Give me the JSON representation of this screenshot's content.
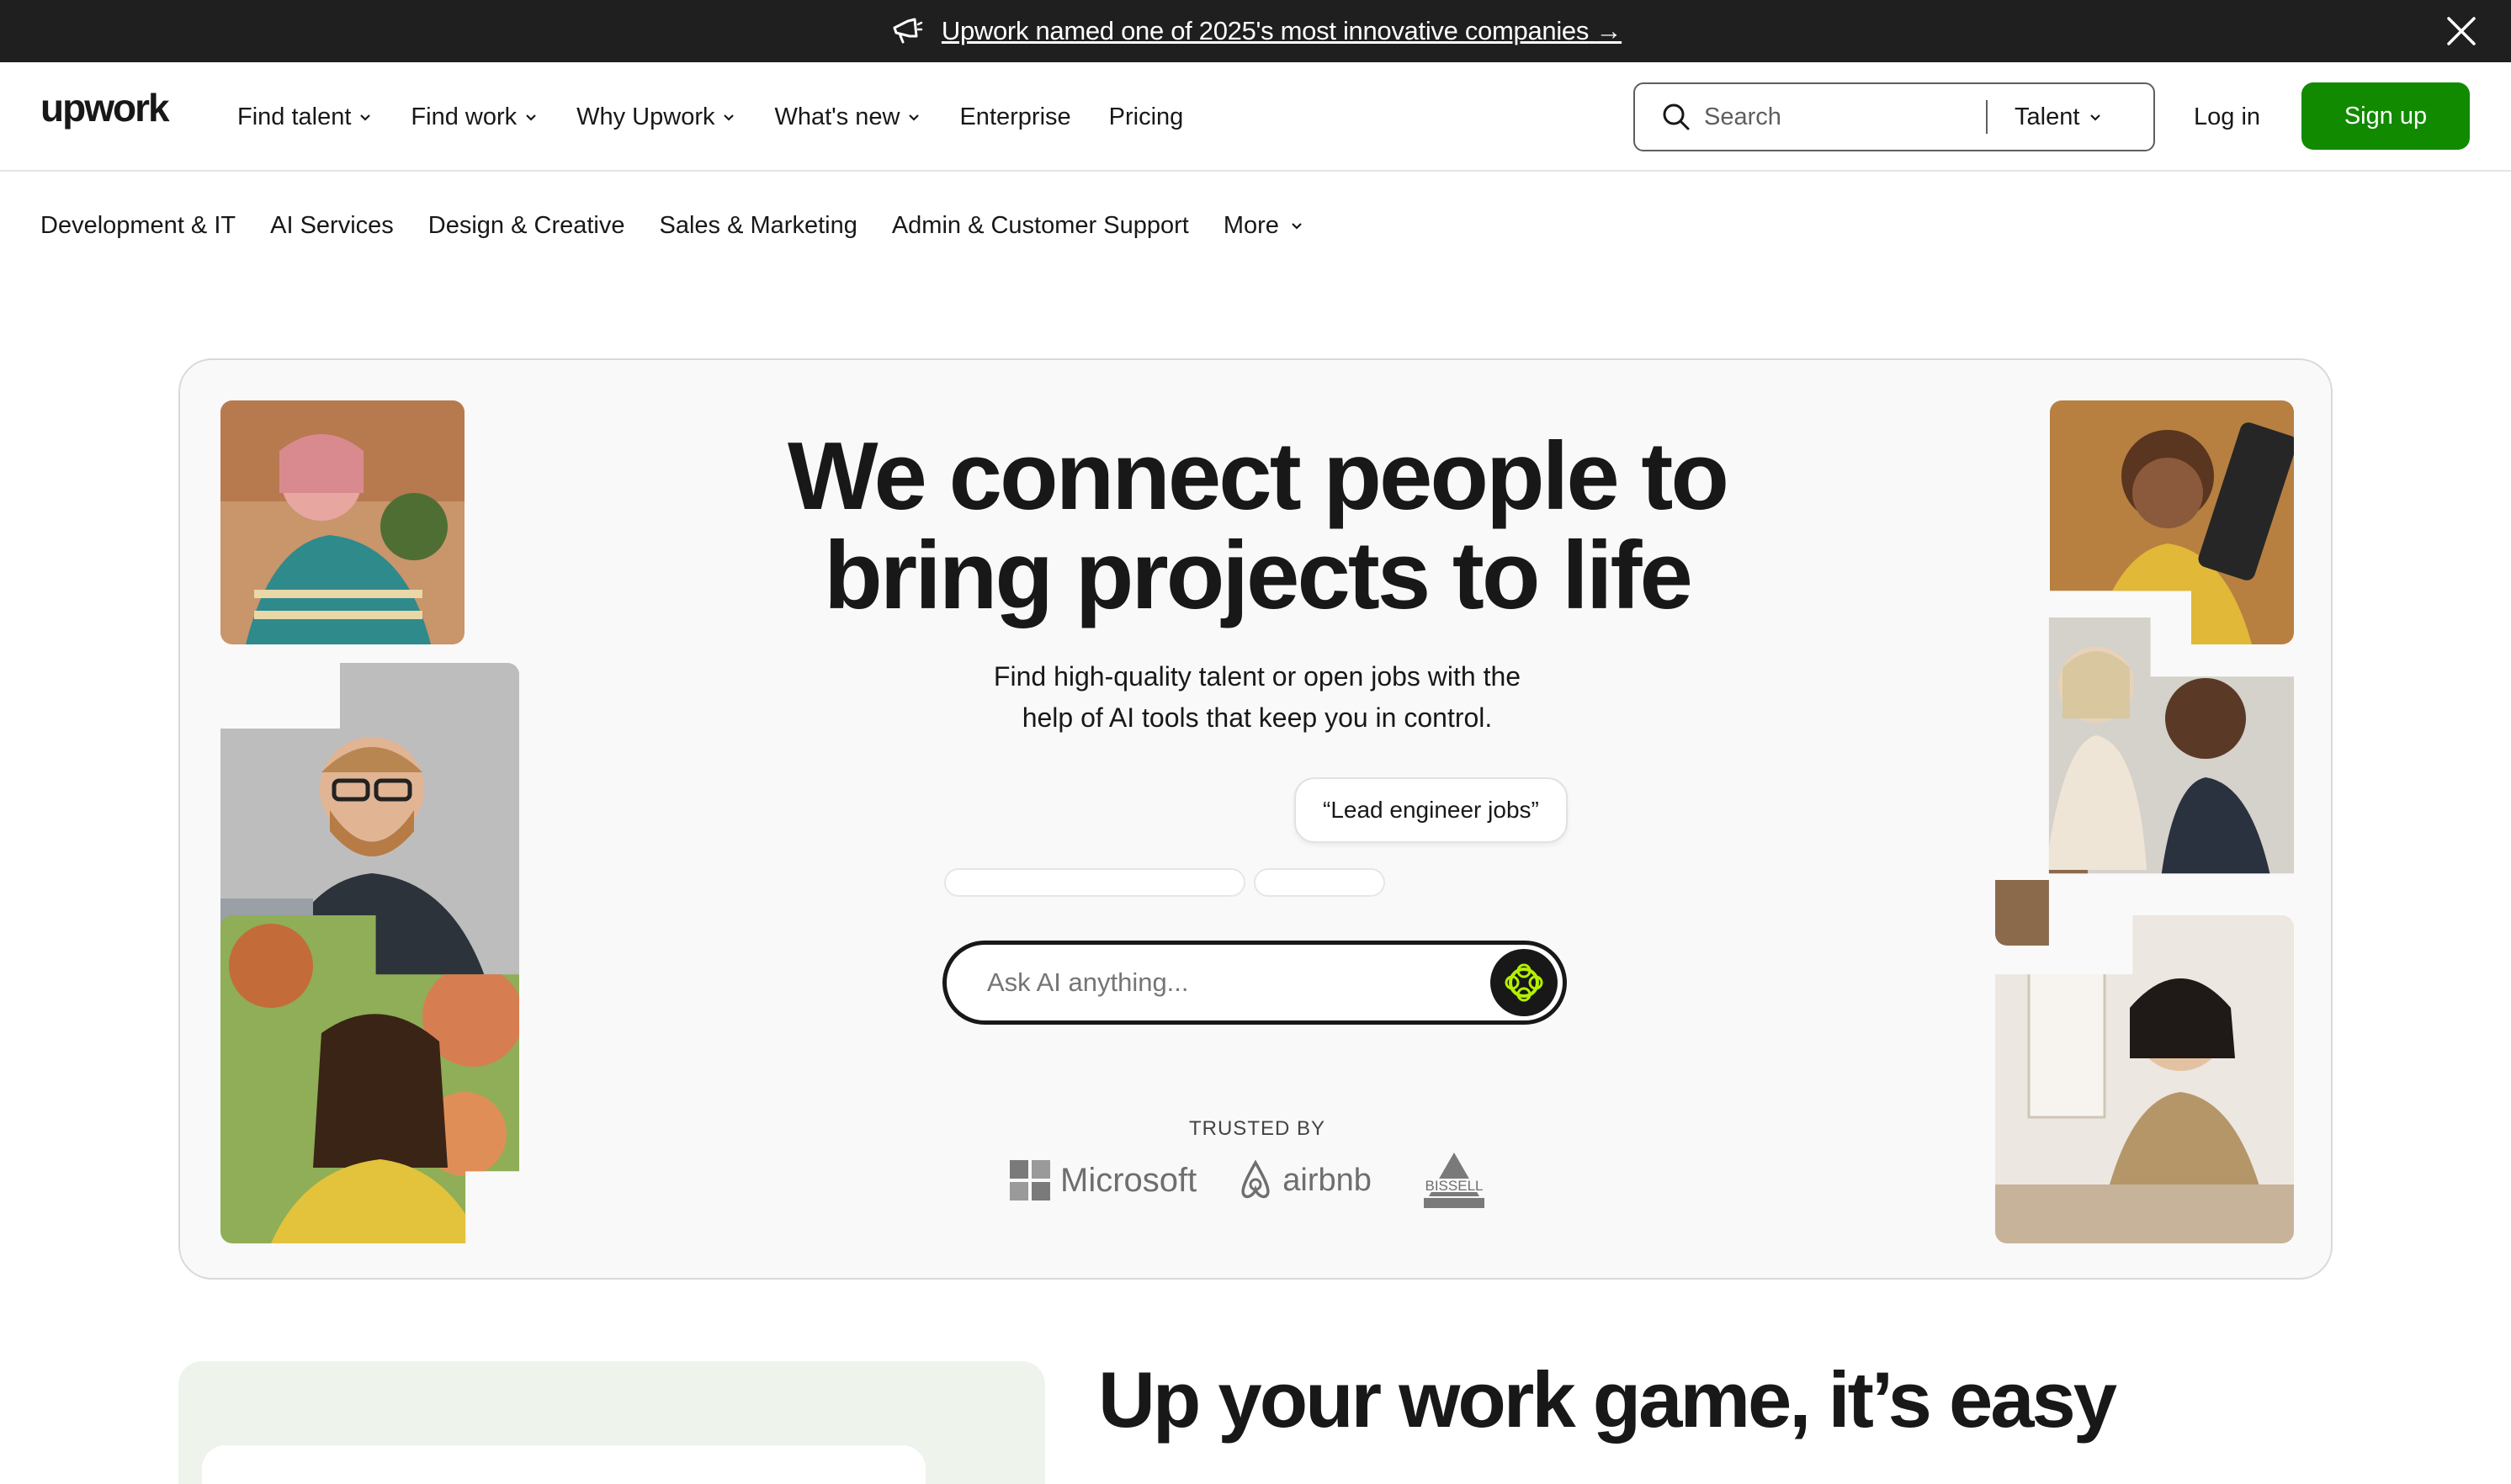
{
  "announcement": {
    "text": "Upwork named one of 2025's most innovative companies",
    "arrow": "→"
  },
  "header": {
    "nav": [
      {
        "label": "Find talent",
        "dropdown": true
      },
      {
        "label": "Find work",
        "dropdown": true
      },
      {
        "label": "Why Upwork",
        "dropdown": true
      },
      {
        "label": "What's new",
        "dropdown": true
      },
      {
        "label": "Enterprise",
        "dropdown": false
      },
      {
        "label": "Pricing",
        "dropdown": false
      }
    ],
    "search_placeholder": "Search",
    "search_scope": "Talent",
    "login": "Log in",
    "signup": "Sign up"
  },
  "categories": [
    "Development & IT",
    "AI Services",
    "Design & Creative",
    "Sales & Marketing",
    "Admin & Customer Support",
    "More"
  ],
  "hero": {
    "title_line1": "We connect people to",
    "title_line2": "bring projects to life",
    "subtitle_line1": "Find high-quality talent or open jobs with the",
    "subtitle_line2": "help of AI tools that keep you in control.",
    "suggestion": "“Lead engineer jobs”",
    "ask_placeholder": "Ask AI anything...",
    "trusted_by": "TRUSTED BY",
    "logos": {
      "microsoft": "Microsoft",
      "airbnb": "airbnb",
      "bissell": "BISSELL"
    }
  },
  "section2": {
    "title": "Up your work game, it’s easy"
  },
  "colors": {
    "brand_green": "#118a00",
    "dark": "#1f1f1f",
    "ai_accent": "#b4f000"
  }
}
